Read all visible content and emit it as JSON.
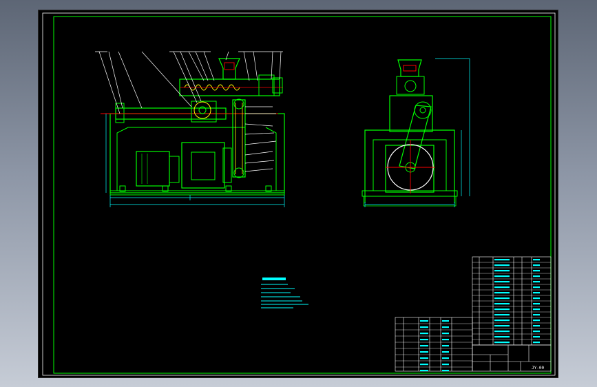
{
  "colors": {
    "background": "#000000",
    "frame": "#00ff00",
    "outline": "#00ff00",
    "centerline": "#ff0000",
    "hatch": "#ffff00",
    "dimension": "#00ffff",
    "leader": "#ffffff",
    "table_line": "#ffffff"
  },
  "drawing": {
    "views": [
      "front-view",
      "side-view"
    ],
    "title_block_code": "JY-00"
  }
}
